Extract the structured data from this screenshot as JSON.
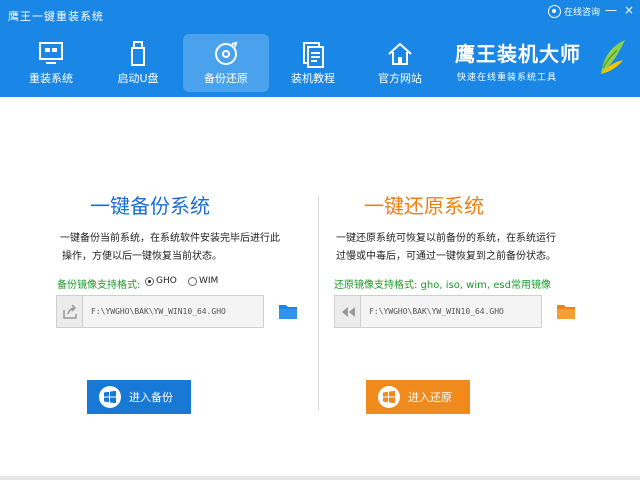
{
  "window": {
    "title": "鹰王一键重装系统",
    "help_label": "在线咨询",
    "min_glyph": "—",
    "close_glyph": "×"
  },
  "nav": [
    {
      "label": "重装系统",
      "icon": "monitor-icon",
      "active": false
    },
    {
      "label": "启动U盘",
      "icon": "usb-drive-icon",
      "active": false
    },
    {
      "label": "备份还原",
      "icon": "backup-disc-icon",
      "active": true
    },
    {
      "label": "装机教程",
      "icon": "document-icon",
      "active": false
    },
    {
      "label": "官方网站",
      "icon": "home-icon",
      "active": false
    }
  ],
  "brand": {
    "name": "鹰王装机大师",
    "slogan": "快速在线重装系统工具",
    "logo": "leaf-logo-icon"
  },
  "backup": {
    "heading": "一键备份系统",
    "desc_line1": "一键备份当前系统，在系统软件安装完毕后进行此",
    "desc_line2": "操作，方便以后一键恢复当前状态。",
    "format_label": "备份镜像支持格式:",
    "options": [
      {
        "label": "GHO",
        "selected": true
      },
      {
        "label": "WIM",
        "selected": false
      }
    ],
    "path": "F:\\YWGHO\\BAK\\YW_WIN10_64.GHO",
    "button": "进入备份",
    "accent": "#1878d6"
  },
  "restore": {
    "heading": "一键还原系统",
    "desc_line1": "一键还原系统可恢复以前备份的系统，在系统运行",
    "desc_line2": "过慢或中毒后，可通过一键恢复到之前备份状态。",
    "format_label": "还原镜像支持格式: gho, iso, wim, esd常用镜像",
    "path": "F:\\YWGHO\\BAK\\YW_WIN10_64.GHO",
    "button": "进入还原",
    "accent": "#f08a1c"
  },
  "colors": {
    "topbar": "#1a86e5",
    "active_tab": "#4aa2ec",
    "format_label": "#1a9a2a"
  }
}
